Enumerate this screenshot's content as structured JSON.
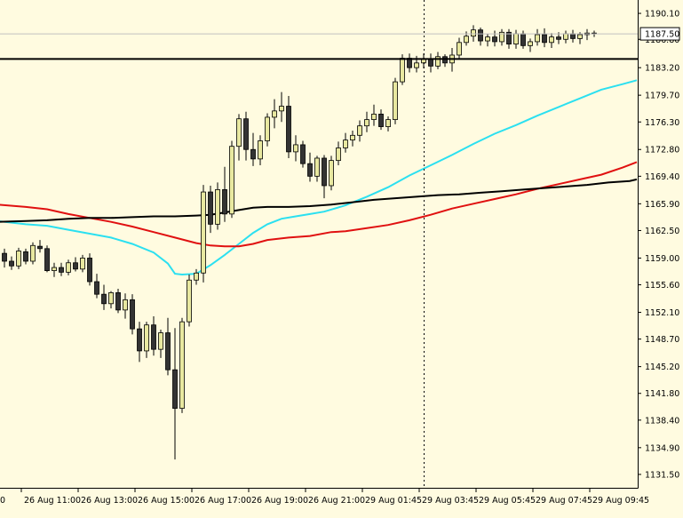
{
  "colors": {
    "background": "#fffbe0",
    "bull_candle": "#e8e8a0",
    "bear_candle": "#333333",
    "ma_fast": "#2be0f0",
    "ma_mid": "#e01010",
    "ma_slow": "#000000",
    "level_line": "#000000",
    "price_tag": "#ffffff"
  },
  "chart_data": {
    "type": "candlestick",
    "grid": false,
    "ylim": [
      1129.8,
      1191.8
    ],
    "y_ticks": [
      "1190.10",
      "1186.80",
      "1183.20",
      "1179.70",
      "1176.30",
      "1172.80",
      "1169.40",
      "1165.90",
      "1162.50",
      "1159.00",
      "1155.60",
      "1152.10",
      "1148.70",
      "1145.20",
      "1141.80",
      "1138.40",
      "1134.90",
      "1131.50"
    ],
    "x_ticks": [
      "26 Aug 11:00",
      "26 Aug 13:00",
      "26 Aug 15:00",
      "26 Aug 17:00",
      "26 Aug 19:00",
      "26 Aug 21:00",
      "29 Aug 01:45",
      "29 Aug 03:45",
      "29 Aug 05:45",
      "29 Aug 07:45",
      "29 Aug 09:45"
    ],
    "x_tick_left_stub": "0",
    "current_price": "1187.50",
    "horizontal_level": 1184.3,
    "vline_index": 59,
    "candles": [
      [
        1159.6,
        1160.2,
        1157.8,
        1158.6
      ],
      [
        1158.6,
        1159.2,
        1157.5,
        1158.0
      ],
      [
        1158.0,
        1160.3,
        1157.6,
        1159.9
      ],
      [
        1159.8,
        1160.2,
        1158.2,
        1158.6
      ],
      [
        1158.6,
        1161.0,
        1158.2,
        1160.6
      ],
      [
        1160.5,
        1161.3,
        1159.7,
        1160.2
      ],
      [
        1160.2,
        1160.6,
        1157.2,
        1157.4
      ],
      [
        1157.4,
        1158.4,
        1156.6,
        1157.8
      ],
      [
        1157.8,
        1158.4,
        1156.7,
        1157.2
      ],
      [
        1157.2,
        1158.8,
        1156.8,
        1158.4
      ],
      [
        1158.4,
        1159.1,
        1157.3,
        1157.6
      ],
      [
        1157.6,
        1159.4,
        1157.2,
        1159.0
      ],
      [
        1159.0,
        1159.6,
        1155.5,
        1156.0
      ],
      [
        1156.0,
        1157.0,
        1153.9,
        1154.4
      ],
      [
        1154.4,
        1155.6,
        1152.4,
        1153.2
      ],
      [
        1153.2,
        1154.8,
        1152.6,
        1154.6
      ],
      [
        1154.6,
        1155.1,
        1152.0,
        1152.4
      ],
      [
        1152.4,
        1154.5,
        1151.3,
        1153.7
      ],
      [
        1153.7,
        1154.4,
        1149.3,
        1150.0
      ],
      [
        1150.0,
        1150.9,
        1145.8,
        1147.2
      ],
      [
        1147.2,
        1150.9,
        1146.3,
        1150.5
      ],
      [
        1150.5,
        1151.6,
        1146.6,
        1147.4
      ],
      [
        1147.4,
        1149.9,
        1146.3,
        1149.5
      ],
      [
        1149.5,
        1151.4,
        1144.1,
        1144.8
      ],
      [
        1144.8,
        1150.1,
        1133.4,
        1139.9
      ],
      [
        1139.9,
        1151.4,
        1139.3,
        1150.9
      ],
      [
        1150.9,
        1156.9,
        1150.3,
        1156.2
      ],
      [
        1156.2,
        1157.6,
        1155.6,
        1157.1
      ],
      [
        1157.1,
        1168.3,
        1155.9,
        1167.4
      ],
      [
        1167.4,
        1168.2,
        1162.2,
        1163.3
      ],
      [
        1163.3,
        1168.6,
        1162.6,
        1167.7
      ],
      [
        1167.7,
        1170.6,
        1163.6,
        1164.6
      ],
      [
        1164.6,
        1173.9,
        1164.1,
        1173.2
      ],
      [
        1173.2,
        1177.3,
        1171.4,
        1176.7
      ],
      [
        1176.7,
        1177.6,
        1171.4,
        1172.8
      ],
      [
        1172.8,
        1174.9,
        1170.7,
        1171.6
      ],
      [
        1171.6,
        1174.6,
        1170.8,
        1173.9
      ],
      [
        1173.9,
        1177.4,
        1173.2,
        1176.9
      ],
      [
        1176.9,
        1179.2,
        1175.5,
        1177.7
      ],
      [
        1177.7,
        1180.1,
        1176.3,
        1178.3
      ],
      [
        1178.3,
        1179.6,
        1171.7,
        1172.5
      ],
      [
        1172.5,
        1174.6,
        1171.3,
        1173.4
      ],
      [
        1173.4,
        1173.9,
        1170.5,
        1171.0
      ],
      [
        1171.0,
        1172.4,
        1168.7,
        1169.4
      ],
      [
        1169.4,
        1172.0,
        1168.7,
        1171.7
      ],
      [
        1171.7,
        1172.1,
        1166.6,
        1168.2
      ],
      [
        1168.2,
        1172.0,
        1167.6,
        1171.4
      ],
      [
        1171.4,
        1173.8,
        1170.8,
        1173.0
      ],
      [
        1173.0,
        1174.9,
        1172.4,
        1174.0
      ],
      [
        1174.0,
        1175.2,
        1173.2,
        1174.6
      ],
      [
        1174.6,
        1176.5,
        1173.8,
        1175.8
      ],
      [
        1175.8,
        1177.6,
        1175.0,
        1176.6
      ],
      [
        1176.6,
        1178.5,
        1175.8,
        1177.3
      ],
      [
        1177.3,
        1177.9,
        1175.3,
        1175.7
      ],
      [
        1175.7,
        1177.0,
        1175.1,
        1176.6
      ],
      [
        1176.6,
        1181.9,
        1176.0,
        1181.4
      ],
      [
        1181.4,
        1184.9,
        1181.0,
        1184.4
      ],
      [
        1184.4,
        1185.0,
        1182.6,
        1183.2
      ],
      [
        1183.2,
        1184.7,
        1182.6,
        1183.8
      ],
      [
        1183.8,
        1185.0,
        1183.1,
        1184.3
      ],
      [
        1184.3,
        1185.0,
        1182.6,
        1183.4
      ],
      [
        1183.4,
        1185.2,
        1183.0,
        1184.6
      ],
      [
        1184.6,
        1184.9,
        1183.3,
        1183.8
      ],
      [
        1183.8,
        1185.7,
        1182.7,
        1184.8
      ],
      [
        1184.8,
        1187.0,
        1184.3,
        1186.4
      ],
      [
        1186.4,
        1187.8,
        1186.0,
        1187.2
      ],
      [
        1187.2,
        1188.6,
        1186.5,
        1188.0
      ],
      [
        1188.0,
        1188.3,
        1186.0,
        1186.6
      ],
      [
        1186.6,
        1187.5,
        1185.9,
        1187.1
      ],
      [
        1187.1,
        1187.9,
        1185.9,
        1186.5
      ],
      [
        1186.5,
        1188.1,
        1186.0,
        1187.7
      ],
      [
        1187.7,
        1188.1,
        1185.6,
        1186.2
      ],
      [
        1186.2,
        1188.0,
        1185.6,
        1187.5
      ],
      [
        1187.5,
        1187.9,
        1185.6,
        1186.0
      ],
      [
        1186.0,
        1186.9,
        1185.2,
        1186.5
      ],
      [
        1186.5,
        1188.1,
        1186.0,
        1187.4
      ],
      [
        1187.4,
        1188.2,
        1185.8,
        1186.4
      ],
      [
        1186.4,
        1187.6,
        1185.7,
        1187.1
      ],
      [
        1187.1,
        1187.7,
        1186.2,
        1186.8
      ],
      [
        1186.8,
        1187.9,
        1186.3,
        1187.5
      ],
      [
        1187.5,
        1188.0,
        1186.4,
        1186.9
      ],
      [
        1186.9,
        1187.7,
        1186.2,
        1187.4
      ],
      [
        1187.4,
        1188.1,
        1186.7,
        1187.6
      ],
      [
        1187.6,
        1187.9,
        1187.1,
        1187.5
      ]
    ],
    "moving_averages": [
      {
        "color_key": "ma_fast",
        "points": [
          [
            -1,
            1163.7
          ],
          [
            3,
            1163.3
          ],
          [
            6,
            1163.1
          ],
          [
            9,
            1162.6
          ],
          [
            12,
            1162.1
          ],
          [
            15,
            1161.6
          ],
          [
            18,
            1160.8
          ],
          [
            21,
            1159.7
          ],
          [
            23,
            1158.3
          ],
          [
            24,
            1157.0
          ],
          [
            25,
            1156.9
          ],
          [
            27,
            1157.0
          ],
          [
            29,
            1158.1
          ],
          [
            31,
            1159.4
          ],
          [
            33,
            1160.8
          ],
          [
            35,
            1162.2
          ],
          [
            37,
            1163.3
          ],
          [
            39,
            1164.0
          ],
          [
            41,
            1164.3
          ],
          [
            43,
            1164.6
          ],
          [
            45,
            1164.9
          ],
          [
            48,
            1165.7
          ],
          [
            51,
            1166.8
          ],
          [
            54,
            1168.0
          ],
          [
            57,
            1169.5
          ],
          [
            60,
            1170.8
          ],
          [
            63,
            1172.1
          ],
          [
            66,
            1173.5
          ],
          [
            69,
            1174.8
          ],
          [
            72,
            1175.9
          ],
          [
            75,
            1177.1
          ],
          [
            78,
            1178.2
          ],
          [
            81,
            1179.3
          ],
          [
            84,
            1180.4
          ],
          [
            87,
            1181.1
          ],
          [
            89,
            1181.6
          ]
        ]
      },
      {
        "color_key": "ma_mid",
        "points": [
          [
            -1,
            1165.8
          ],
          [
            3,
            1165.5
          ],
          [
            6,
            1165.2
          ],
          [
            9,
            1164.6
          ],
          [
            12,
            1164.1
          ],
          [
            15,
            1163.6
          ],
          [
            18,
            1163.0
          ],
          [
            21,
            1162.3
          ],
          [
            24,
            1161.6
          ],
          [
            27,
            1160.9
          ],
          [
            29,
            1160.6
          ],
          [
            31,
            1160.5
          ],
          [
            33,
            1160.5
          ],
          [
            35,
            1160.8
          ],
          [
            37,
            1161.3
          ],
          [
            40,
            1161.6
          ],
          [
            43,
            1161.8
          ],
          [
            46,
            1162.3
          ],
          [
            48,
            1162.4
          ],
          [
            51,
            1162.8
          ],
          [
            54,
            1163.2
          ],
          [
            57,
            1163.8
          ],
          [
            60,
            1164.5
          ],
          [
            63,
            1165.3
          ],
          [
            66,
            1165.9
          ],
          [
            69,
            1166.5
          ],
          [
            72,
            1167.1
          ],
          [
            75,
            1167.8
          ],
          [
            78,
            1168.4
          ],
          [
            81,
            1169.0
          ],
          [
            84,
            1169.6
          ],
          [
            87,
            1170.5
          ],
          [
            89,
            1171.2
          ]
        ]
      },
      {
        "color_key": "ma_slow",
        "points": [
          [
            -1,
            1163.6
          ],
          [
            3,
            1163.7
          ],
          [
            6,
            1163.8
          ],
          [
            9,
            1164.0
          ],
          [
            12,
            1164.1
          ],
          [
            15,
            1164.1
          ],
          [
            18,
            1164.2
          ],
          [
            21,
            1164.3
          ],
          [
            24,
            1164.3
          ],
          [
            27,
            1164.4
          ],
          [
            29,
            1164.5
          ],
          [
            31,
            1164.8
          ],
          [
            33,
            1165.1
          ],
          [
            35,
            1165.4
          ],
          [
            37,
            1165.5
          ],
          [
            40,
            1165.5
          ],
          [
            43,
            1165.6
          ],
          [
            46,
            1165.8
          ],
          [
            49,
            1166.1
          ],
          [
            52,
            1166.4
          ],
          [
            55,
            1166.6
          ],
          [
            58,
            1166.8
          ],
          [
            61,
            1167.0
          ],
          [
            64,
            1167.1
          ],
          [
            67,
            1167.3
          ],
          [
            70,
            1167.5
          ],
          [
            73,
            1167.7
          ],
          [
            76,
            1167.9
          ],
          [
            79,
            1168.1
          ],
          [
            82,
            1168.3
          ],
          [
            85,
            1168.6
          ],
          [
            88,
            1168.8
          ],
          [
            89,
            1169.0
          ]
        ]
      }
    ]
  }
}
